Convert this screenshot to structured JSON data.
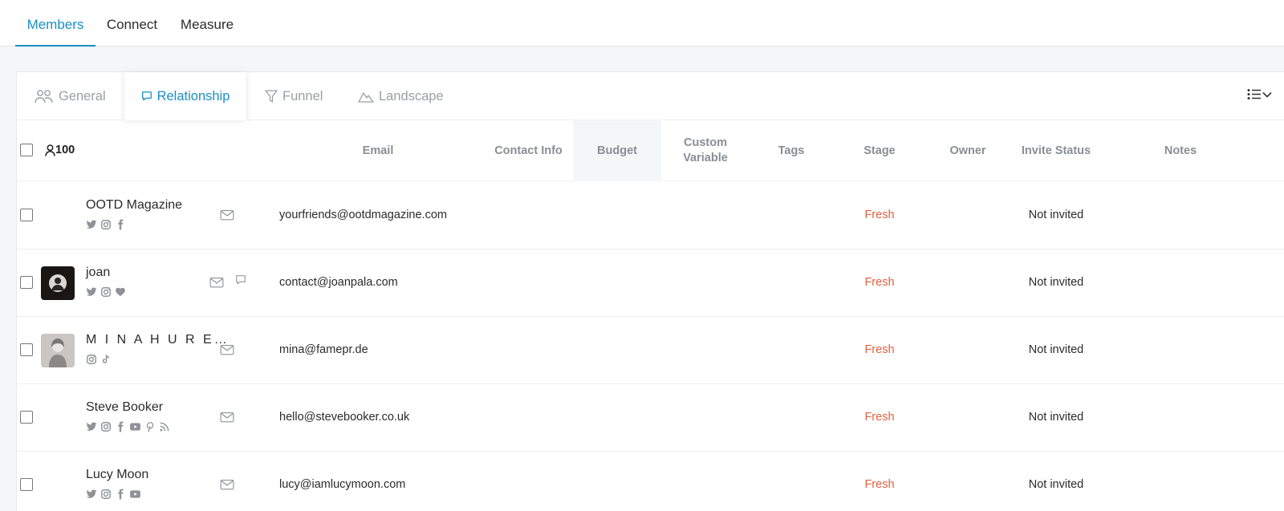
{
  "topnav": {
    "tabs": [
      {
        "label": "Members"
      },
      {
        "label": "Connect"
      },
      {
        "label": "Measure"
      }
    ]
  },
  "subtabs": [
    {
      "label": "General"
    },
    {
      "label": "Relationship"
    },
    {
      "label": "Funnel"
    },
    {
      "label": "Landscape"
    }
  ],
  "table": {
    "member_count": "100",
    "columns": {
      "email": "Email",
      "contact_info": "Contact Info",
      "budget": "Budget",
      "custom_variable_1": "Custom",
      "custom_variable_2": "Variable",
      "tags": "Tags",
      "stage": "Stage",
      "owner": "Owner",
      "invite_status": "Invite Status",
      "notes": "Notes"
    },
    "rows": [
      {
        "name": "OOTD Magazine",
        "email": "yourfriends@ootdmagazine.com",
        "stage": "Fresh",
        "invite_status": "Not invited",
        "socials": [
          "twitter-icon",
          "instagram-icon",
          "facebook-icon"
        ]
      },
      {
        "name": "joan",
        "email": "contact@joanpala.com",
        "stage": "Fresh",
        "invite_status": "Not invited",
        "socials": [
          "twitter-icon",
          "instagram-icon",
          "heart-icon"
        ]
      },
      {
        "name": "M I N A H U R E…",
        "email": "mina@famepr.de",
        "stage": "Fresh",
        "invite_status": "Not invited",
        "socials": [
          "instagram-icon",
          "tiktok-icon"
        ]
      },
      {
        "name": "Steve Booker",
        "email": "hello@stevebooker.co.uk",
        "stage": "Fresh",
        "invite_status": "Not invited",
        "socials": [
          "twitter-icon",
          "instagram-icon",
          "facebook-icon",
          "youtube-icon",
          "pinterest-icon",
          "rss-icon"
        ]
      },
      {
        "name": "Lucy Moon",
        "email": "lucy@iamlucymoon.com",
        "stage": "Fresh",
        "invite_status": "Not invited",
        "socials": [
          "twitter-icon",
          "instagram-icon",
          "facebook-icon",
          "youtube-icon"
        ]
      }
    ]
  },
  "colors": {
    "accent": "#1a8fc4",
    "stage_fresh": "#e0603c",
    "muted": "#9a9ea3"
  }
}
